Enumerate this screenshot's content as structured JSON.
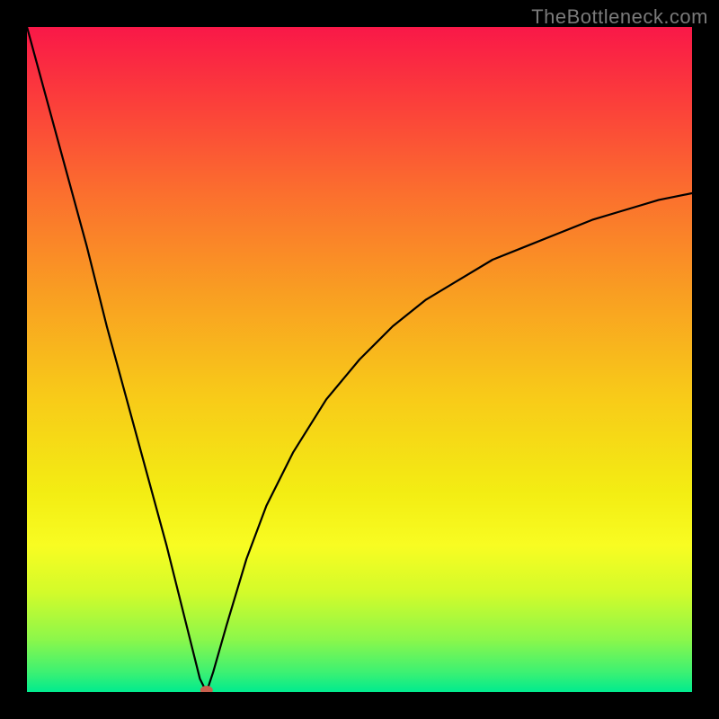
{
  "watermark": "TheBottleneck.com",
  "chart_data": {
    "type": "line",
    "title": "",
    "xlabel": "",
    "ylabel": "",
    "xlim": [
      0,
      100
    ],
    "ylim": [
      0,
      100
    ],
    "grid": false,
    "legend": null,
    "background_gradient_stops": [
      {
        "offset": 0.0,
        "color": "#f91848"
      },
      {
        "offset": 0.1,
        "color": "#fb3a3c"
      },
      {
        "offset": 0.25,
        "color": "#fb6f2e"
      },
      {
        "offset": 0.4,
        "color": "#f99e22"
      },
      {
        "offset": 0.55,
        "color": "#f8c919"
      },
      {
        "offset": 0.7,
        "color": "#f3ed13"
      },
      {
        "offset": 0.78,
        "color": "#f8fc22"
      },
      {
        "offset": 0.85,
        "color": "#d3fb2a"
      },
      {
        "offset": 0.92,
        "color": "#8df74a"
      },
      {
        "offset": 0.97,
        "color": "#3df172"
      },
      {
        "offset": 1.0,
        "color": "#00eb8f"
      }
    ],
    "series": [
      {
        "name": "bottleneck-curve",
        "comment": "y is bottleneck percentage (0=optimal at bottom, 100=worst at top). Curve dips to ~0 near x≈27 and rises steeply on both sides; left branch near-linear to 100 at x=0, right branch asymptotic toward ~75 at x=100.",
        "x": [
          0,
          3,
          6,
          9,
          12,
          15,
          18,
          21,
          24,
          26,
          27,
          28,
          30,
          33,
          36,
          40,
          45,
          50,
          55,
          60,
          65,
          70,
          75,
          80,
          85,
          90,
          95,
          100
        ],
        "y": [
          100,
          89,
          78,
          67,
          55,
          44,
          33,
          22,
          10,
          2,
          0,
          3,
          10,
          20,
          28,
          36,
          44,
          50,
          55,
          59,
          62,
          65,
          67,
          69,
          71,
          72.5,
          74,
          75
        ]
      }
    ],
    "marker": {
      "name": "optimal-point",
      "x": 27,
      "y": 0,
      "color": "#c9604e",
      "rx": 7,
      "ry": 5
    }
  }
}
